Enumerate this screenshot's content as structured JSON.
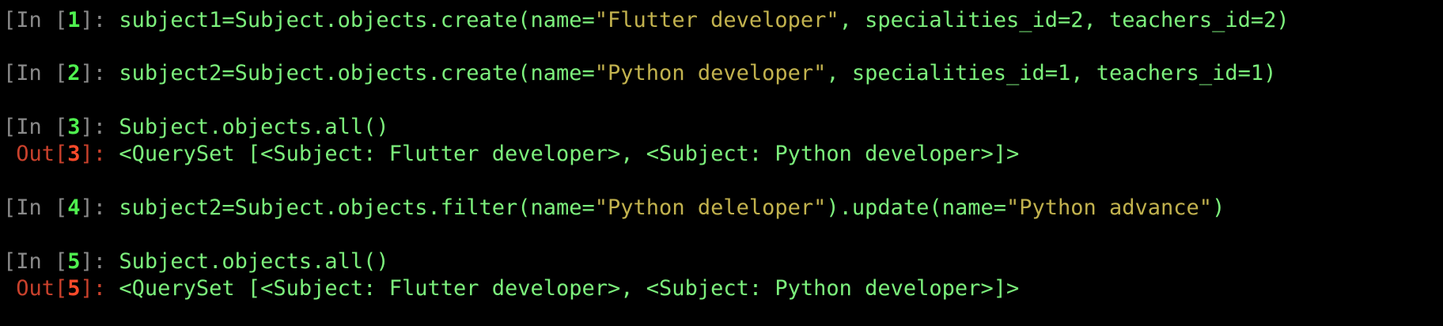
{
  "colors": {
    "background": "#000000",
    "code": "#7cf07c",
    "string": "#c2b24e",
    "in_prompt": "#8a8a8a",
    "in_number": "#4ff04f",
    "out_prompt": "#c9412c",
    "out_number": "#ff4a2a"
  },
  "cells": [
    {
      "type": "in",
      "open": "[In [",
      "num": "1",
      "close": "]: ",
      "parts": [
        {
          "kind": "code",
          "text": "subject1=Subject.objects.create(name="
        },
        {
          "kind": "str",
          "text": "\"Flutter developer\""
        },
        {
          "kind": "code",
          "text": ", specialities_id="
        },
        {
          "kind": "num",
          "text": "2"
        },
        {
          "kind": "code",
          "text": ", teachers_id="
        },
        {
          "kind": "num",
          "text": "2"
        },
        {
          "kind": "code",
          "text": ")"
        }
      ]
    },
    {
      "type": "in",
      "open": "[In [",
      "num": "2",
      "close": "]: ",
      "parts": [
        {
          "kind": "code",
          "text": "subject2=Subject.objects.create(name="
        },
        {
          "kind": "str",
          "text": "\"Python developer\""
        },
        {
          "kind": "code",
          "text": ", specialities_id="
        },
        {
          "kind": "num",
          "text": "1"
        },
        {
          "kind": "code",
          "text": ", teachers_id="
        },
        {
          "kind": "num",
          "text": "1"
        },
        {
          "kind": "code",
          "text": ")"
        }
      ]
    },
    {
      "type": "in",
      "open": "[In [",
      "num": "3",
      "close": "]: ",
      "parts": [
        {
          "kind": "code",
          "text": "Subject.objects.all()"
        }
      ]
    },
    {
      "type": "out",
      "open": " Out[",
      "num": "3",
      "close": "]: ",
      "parts": [
        {
          "kind": "code",
          "text": "<QuerySet [<Subject: Flutter developer>, <Subject: Python developer>]>"
        }
      ]
    },
    {
      "type": "in",
      "open": "[In [",
      "num": "4",
      "close": "]: ",
      "parts": [
        {
          "kind": "code",
          "text": "subject2=Subject.objects.filter(name="
        },
        {
          "kind": "str",
          "text": "\"Python deleloper\""
        },
        {
          "kind": "code",
          "text": ").update(name="
        },
        {
          "kind": "str",
          "text": "\"Python advance\""
        },
        {
          "kind": "code",
          "text": ")"
        }
      ]
    },
    {
      "type": "in",
      "open": "[In [",
      "num": "5",
      "close": "]: ",
      "parts": [
        {
          "kind": "code",
          "text": "Subject.objects.all()"
        }
      ]
    },
    {
      "type": "out",
      "open": " Out[",
      "num": "5",
      "close": "]: ",
      "parts": [
        {
          "kind": "code",
          "text": "<QuerySet [<Subject: Flutter developer>, <Subject: Python developer>]>"
        }
      ]
    }
  ]
}
